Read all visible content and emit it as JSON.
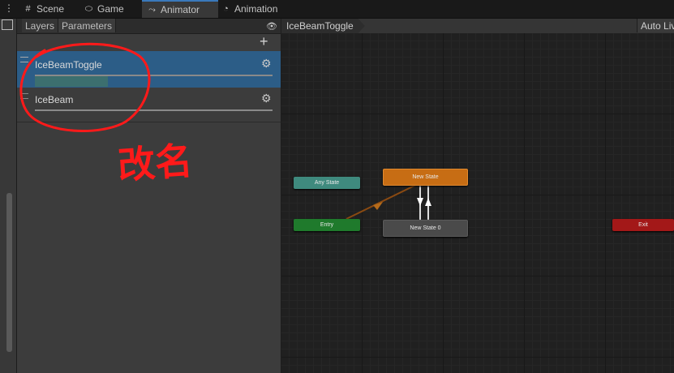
{
  "tabs": [
    {
      "label": "Scene",
      "icon": "grid-icon"
    },
    {
      "label": "Game",
      "icon": "gamepad-icon"
    },
    {
      "label": "Animator",
      "icon": "animator-icon"
    },
    {
      "label": "Animation",
      "icon": "clock-icon"
    }
  ],
  "left_panel": {
    "subtabs": [
      "Layers",
      "Parameters"
    ],
    "add_label": "+",
    "params": [
      {
        "name": "IceBeamToggle"
      },
      {
        "name": "IceBeam"
      }
    ]
  },
  "graph": {
    "breadcrumb": "IceBeamToggle",
    "auto_live_label": "Auto Liv",
    "states": {
      "any": "Any State",
      "new": "New State",
      "entry": "Entry",
      "new0": "New State 0",
      "exit": "Exit"
    }
  },
  "annotation": {
    "text": "改名"
  },
  "colors": {
    "accent": "#3a79bb",
    "annotation": "#ff1a1a",
    "orange_state": "#c76d14",
    "entry_state": "#1f7a2c",
    "exit_state": "#a31818",
    "any_state": "#3f8a7e"
  }
}
